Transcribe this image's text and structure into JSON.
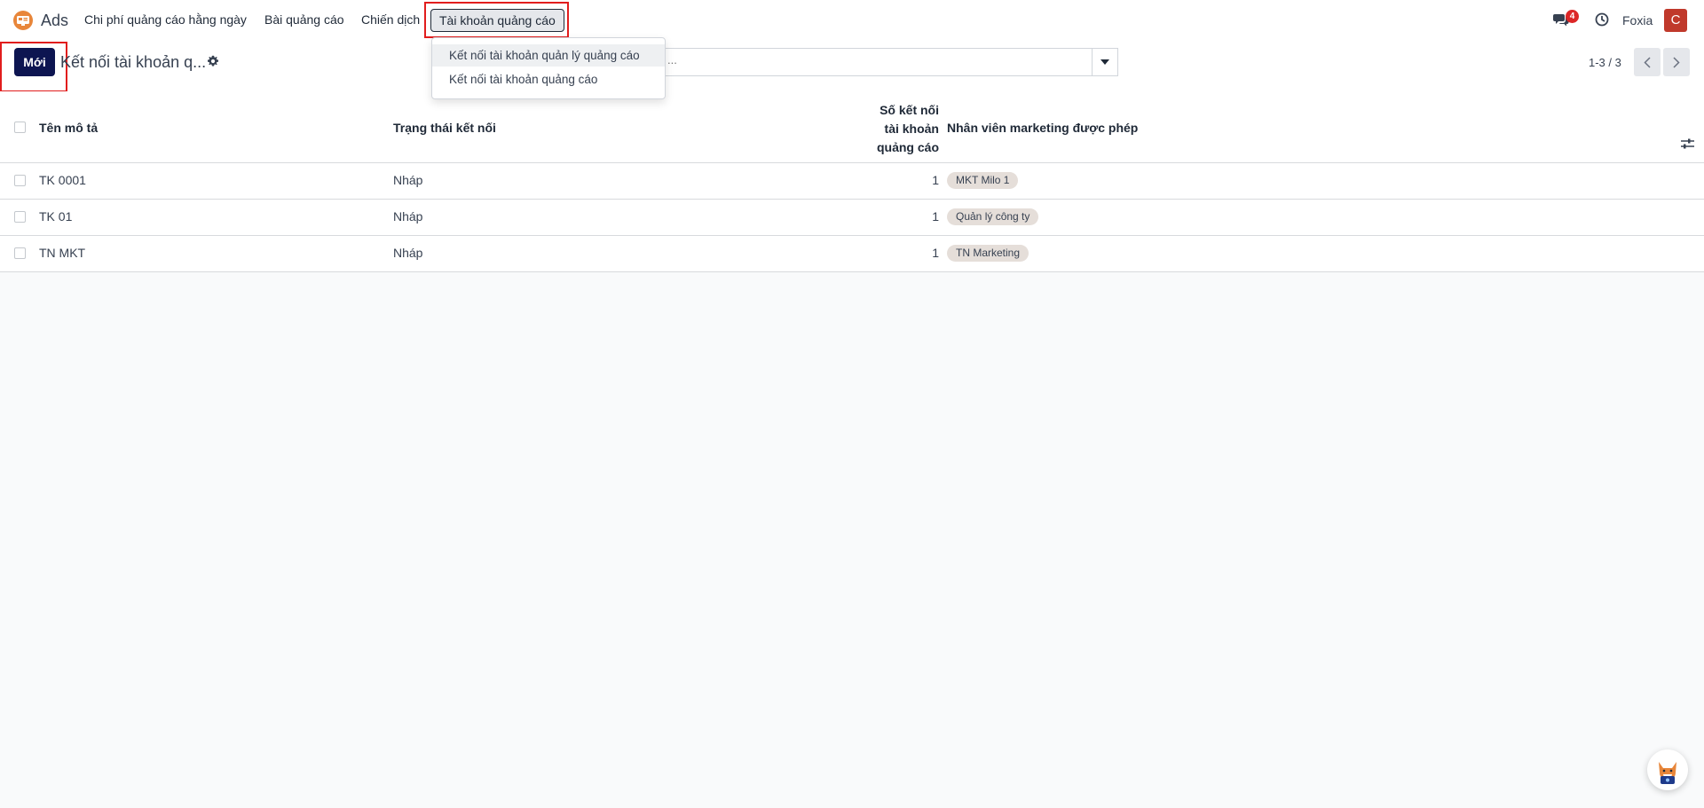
{
  "app": {
    "name": "Ads"
  },
  "menu": [
    {
      "label": "Chi phí quảng cáo hằng ngày"
    },
    {
      "label": "Bài quảng cáo"
    },
    {
      "label": "Chiến dịch"
    },
    {
      "label": "Tài khoản quảng cáo"
    }
  ],
  "navbar": {
    "messages_badge": "4",
    "company": "Foxia",
    "avatar_letter": "C"
  },
  "control": {
    "new_label": "Mới",
    "title": "Kết nối tài khoản q...",
    "search_placeholder": "...",
    "pager": "1-3 / 3"
  },
  "dropdown": [
    {
      "label": "Kết nối tài khoản quản lý quảng cáo"
    },
    {
      "label": "Kết nối tài khoản quảng cáo"
    }
  ],
  "table": {
    "headers": {
      "name": "Tên mô tả",
      "status": "Trạng thái kết nối",
      "count_line1": "Số kết nối",
      "count_line2": "tài khoản",
      "count_line3": "quảng cáo",
      "marketers": "Nhân viên marketing được phép"
    },
    "rows": [
      {
        "name": "TK 0001",
        "status": "Nháp",
        "count": "1",
        "tag": "MKT Milo 1"
      },
      {
        "name": "TK 01",
        "status": "Nháp",
        "count": "1",
        "tag": "Quản lý công ty"
      },
      {
        "name": "TN MKT",
        "status": "Nháp",
        "count": "1",
        "tag": "TN Marketing"
      }
    ]
  },
  "colors": {
    "primary": "#0d1551",
    "highlight": "#e11d1d",
    "badge": "#dc2626"
  }
}
